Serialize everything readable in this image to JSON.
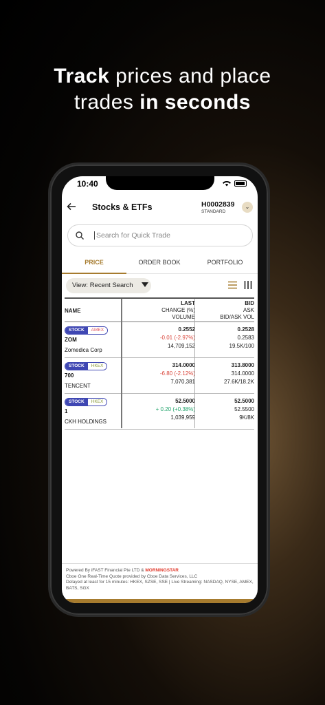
{
  "headline": {
    "line1_bold": "Track",
    "line1_rest": " prices and place",
    "line2_rest": "trades ",
    "line2_bold": "in seconds"
  },
  "status_bar": {
    "time": "10:40"
  },
  "header": {
    "title": "Stocks & ETFs",
    "account_id": "H0002839",
    "account_type": "STANDARD"
  },
  "search": {
    "placeholder": "Search for Quick Trade"
  },
  "tabs": [
    {
      "label": "PRICE",
      "active": true
    },
    {
      "label": "ORDER BOOK",
      "active": false
    },
    {
      "label": "PORTFOLIO",
      "active": false
    }
  ],
  "view": {
    "label": "View: Recent Search"
  },
  "table": {
    "headers": {
      "name": "NAME",
      "last": "LAST",
      "change": "CHANGE (%)",
      "volume": "VOLUME",
      "bid": "BID",
      "ask": "ASK",
      "bidask_vol": "BID/ASK VOL"
    },
    "rows": [
      {
        "type": "STOCK",
        "exchange": "AMEX",
        "exchange_color": "#e0535a",
        "symbol": "ZOM",
        "name": "Zomedica Corp",
        "last": "0.2552",
        "change": "-0.01 (-2.97%)",
        "direction": "neg",
        "volume": "14,709,152",
        "bid": "0.2528",
        "ask": "0.2583",
        "bidask_vol": "19.5K/100"
      },
      {
        "type": "STOCK",
        "exchange": "HKEX",
        "exchange_color": "#8a9a3a",
        "symbol": "700",
        "name": "TENCENT",
        "last": "314.0000",
        "change": "-6.80 (-2.12%)",
        "direction": "neg",
        "volume": "7,070,381",
        "bid": "313.8000",
        "ask": "314.0000",
        "bidask_vol": "27.6K/18.2K"
      },
      {
        "type": "STOCK",
        "exchange": "HKEX",
        "exchange_color": "#8a9a3a",
        "symbol": "1",
        "name": "CKH HOLDINGS",
        "last": "52.5000",
        "change": "+ 0.20 (+0.38%)",
        "direction": "pos",
        "volume": "1,039,959",
        "bid": "52.5000",
        "ask": "52.5500",
        "bidask_vol": "9K/8K"
      }
    ]
  },
  "footer": {
    "powered": "Powered By iFAST Financial Pte LTD &",
    "morningstar": "MORNINGSTAR",
    "line2": "Cboe One Real-Time Quote provided by Cboe Data Services, LLC",
    "line3": "Delayed at least for 15 minutes: HKEX, SZSE, SSE | Live Streaming: NASDAQ, NYSE, AMEX, BATS, SGX"
  },
  "colors": {
    "accent": "#a67b2e",
    "stock_badge": "#3f47b3",
    "negative": "#d9453a",
    "positive": "#1fa36a"
  }
}
